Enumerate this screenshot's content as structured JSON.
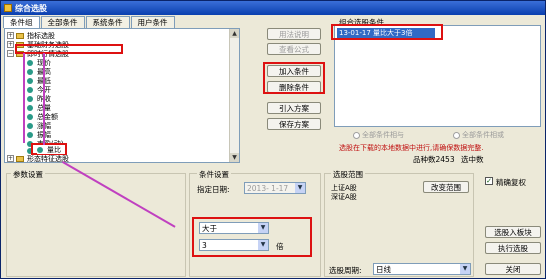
{
  "window": {
    "title": "综合选股"
  },
  "tabs": [
    "条件组",
    "全部条件",
    "系统条件",
    "用户条件"
  ],
  "tree": {
    "folders": [
      "指标选股",
      "基础财务选股",
      "即时行情选股"
    ],
    "items": [
      "现价",
      "最高",
      "最低",
      "今开",
      "昨收",
      "总量",
      "总金额",
      "涨幅",
      "振幅",
      "市盈(动)",
      "换手率",
      "量比"
    ],
    "last_folder": "形态特征选股"
  },
  "buttons": {
    "usage": "用法说明",
    "formula": "查看公式",
    "add": "加入条件",
    "delete": "删除条件",
    "import": "引入方案",
    "save": "保存方案",
    "range": "改变范围",
    "add_board": "选股入板块",
    "exec": "执行选股",
    "close": "关闭"
  },
  "cond_group": {
    "title": "组合选股条件",
    "items": [
      "13-01-17 量比大于3倍"
    ]
  },
  "radios": [
    "全部条件相与",
    "全部条件相或"
  ],
  "note": "选股在下载的本地数据中进行,请确保数据完整.",
  "count_label": "品种数2453",
  "ratio_label": "选中数",
  "params": {
    "title": "参数设置"
  },
  "cond_settings": {
    "title": "条件设置",
    "date_label": "指定日期:",
    "date_value": "2013- 1-17",
    "compare": "大于",
    "value": "3",
    "unit": "倍"
  },
  "range": {
    "title": "选股范围",
    "items": [
      "上证A股",
      "深证A股"
    ]
  },
  "period": {
    "label": "选股周期:",
    "value": "日线"
  },
  "exact": {
    "label": "精确复权",
    "checked": true
  }
}
